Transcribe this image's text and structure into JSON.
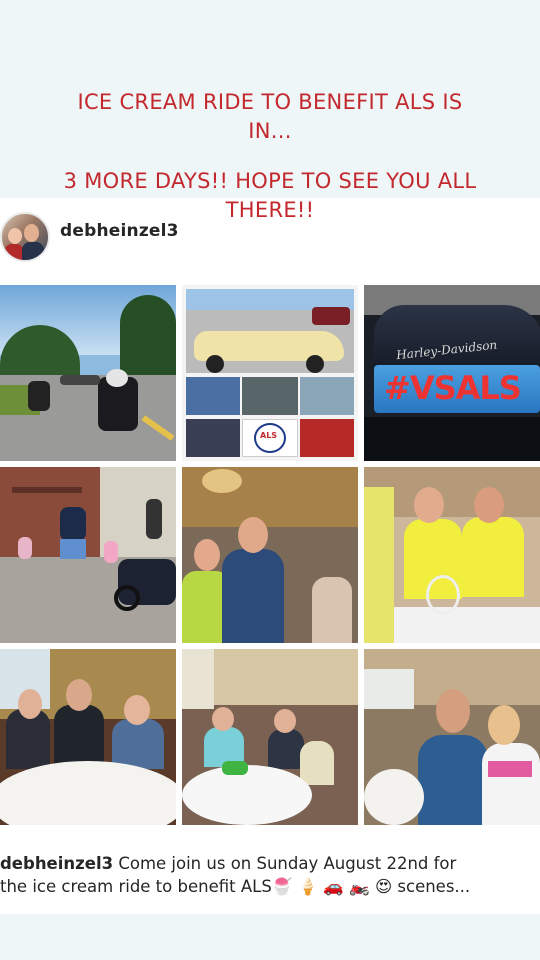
{
  "story": {
    "headline_line1": "ICE CREAM RIDE TO BENEFIT ALS IS",
    "headline_line1b": "IN...",
    "headline_line2": "3 MORE DAYS!! HOPE TO SEE YOU ALL",
    "headline_line2b": "THERE!!"
  },
  "post": {
    "username": "debheinzel3",
    "caption_user": "debheinzel3",
    "caption_text_1": " Come join us on Sunday August 22nd for",
    "caption_text_2": "the ice cream ride to benefit ALS",
    "caption_emojis": "🍧 🍦 🚗 🏍️ 😍",
    "caption_more": " scenes..."
  },
  "photos": {
    "harley_text": "Harley-Davidson",
    "vsals_text": "#VSALS",
    "sign_text": "ALS"
  },
  "colors": {
    "headline": "#c3282d",
    "background": "#eef6f8",
    "card": "#ffffff"
  }
}
